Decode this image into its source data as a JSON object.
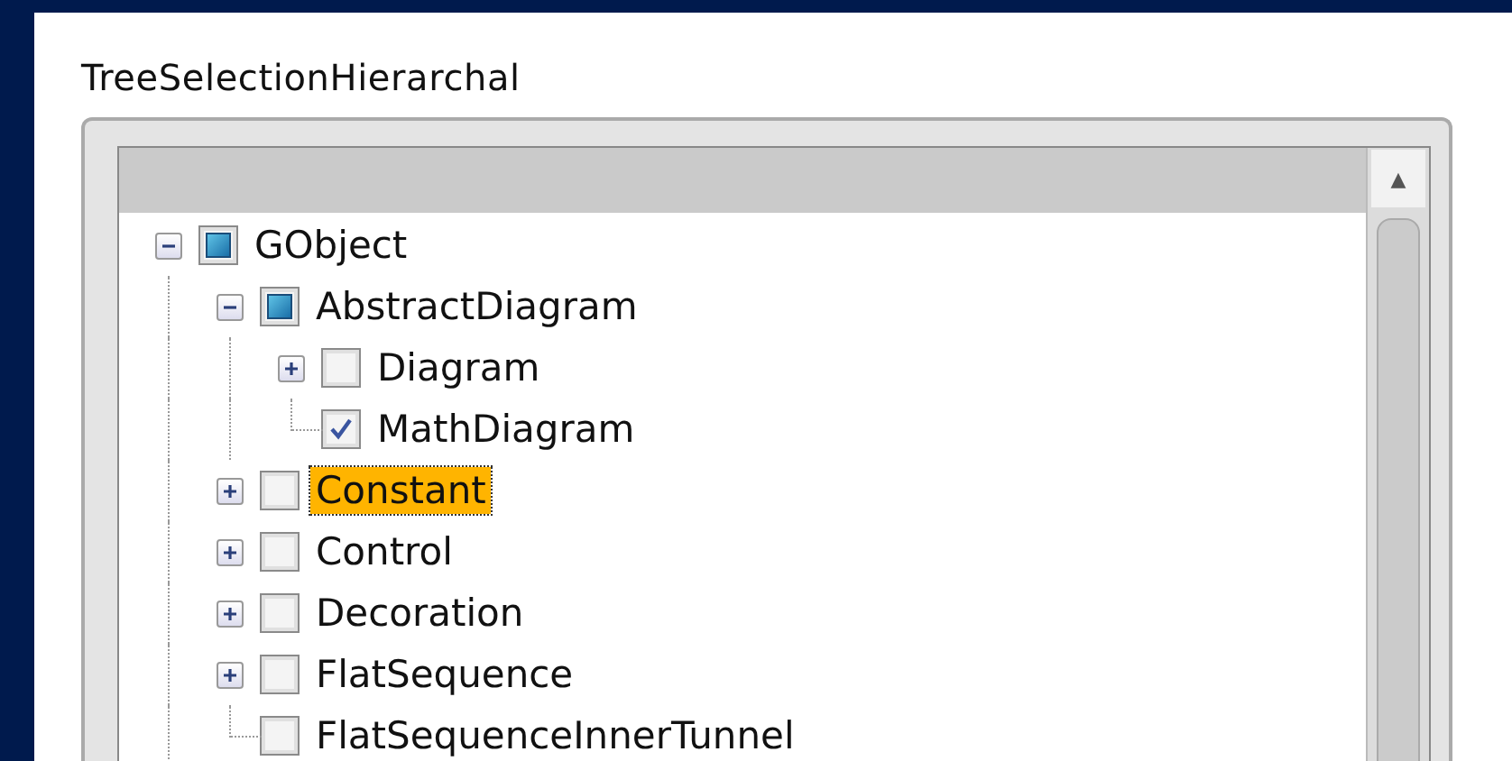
{
  "title": "TreeSelectionHierarchal",
  "scrollbar": {
    "up_arrow": "▲"
  },
  "tree": [
    {
      "label": "GObject",
      "checked": false,
      "partial": true,
      "expanded": true,
      "selected": false,
      "children": [
        {
          "label": "AbstractDiagram",
          "checked": false,
          "partial": true,
          "expanded": true,
          "selected": false,
          "children": [
            {
              "label": "Diagram",
              "checked": false,
              "partial": false,
              "expanded": false,
              "selected": false
            },
            {
              "label": "MathDiagram",
              "checked": true,
              "partial": false,
              "selected": false
            }
          ]
        },
        {
          "label": "Constant",
          "checked": false,
          "partial": false,
          "expanded": false,
          "selected": true
        },
        {
          "label": "Control",
          "checked": false,
          "partial": false,
          "expanded": false,
          "selected": false
        },
        {
          "label": "Decoration",
          "checked": false,
          "partial": false,
          "expanded": false,
          "selected": false
        },
        {
          "label": "FlatSequence",
          "checked": false,
          "partial": false,
          "expanded": false,
          "selected": false
        },
        {
          "label": "FlatSequenceInnerTunnel",
          "checked": false,
          "partial": false,
          "selected": false
        }
      ]
    }
  ]
}
